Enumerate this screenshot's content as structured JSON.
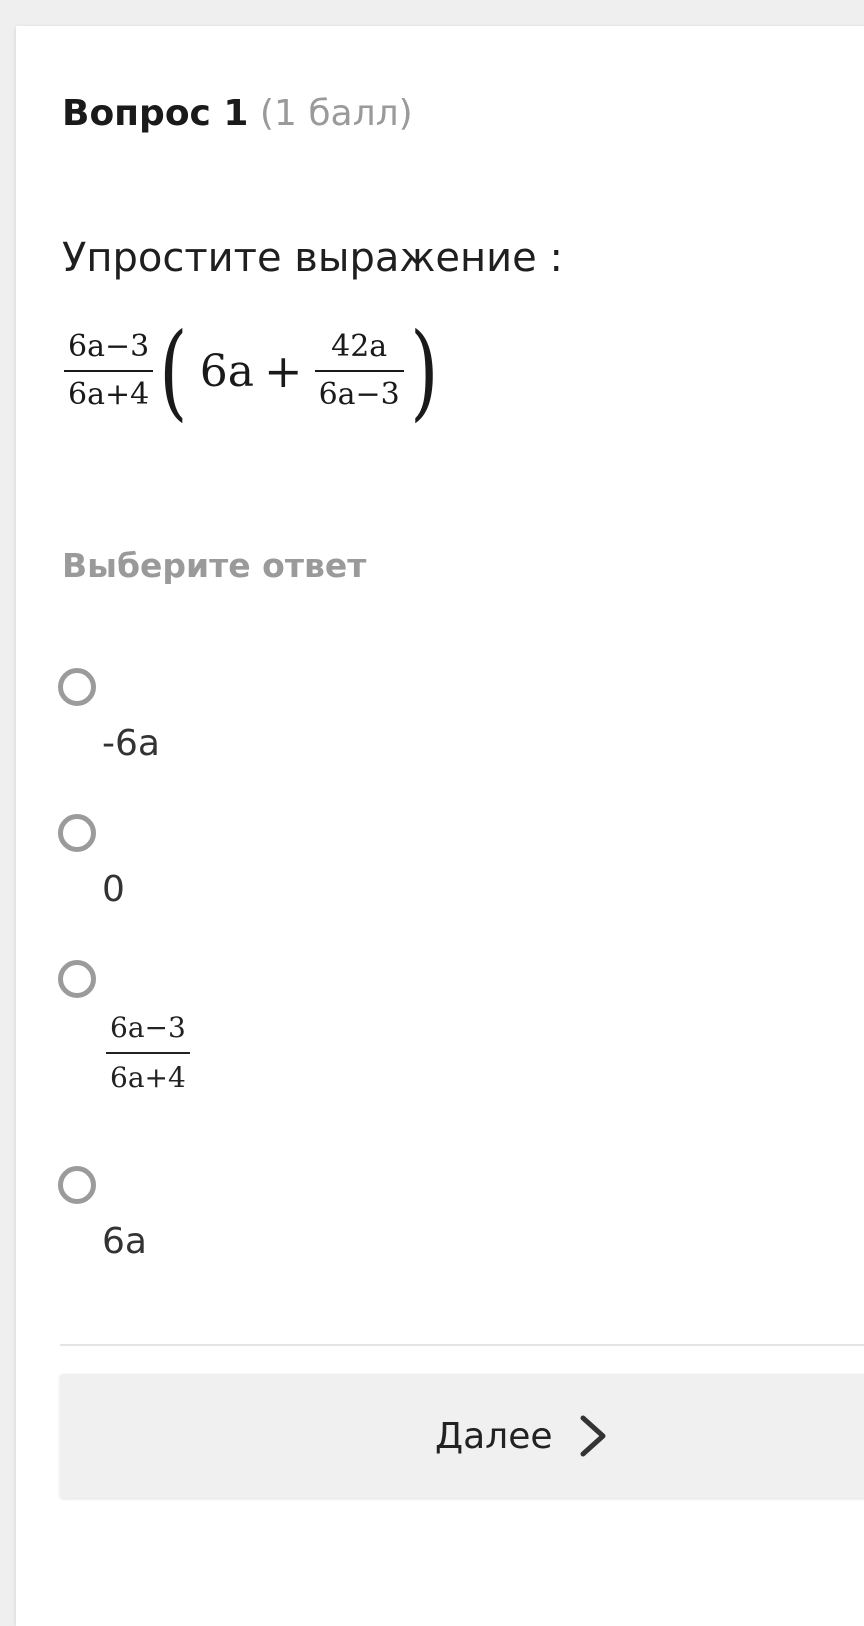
{
  "question": {
    "title": "Вопрос 1",
    "points": "(1 балл)",
    "text": "Упростите выражение :",
    "expression": {
      "outer_fraction": {
        "numerator": "6a−3",
        "denominator": "6a+4"
      },
      "open_paren": "(",
      "term": "6a",
      "operator": "+",
      "inner_fraction": {
        "numerator": "42a",
        "denominator": "6a−3"
      },
      "close_paren": ")"
    }
  },
  "answers": {
    "label": "Выберите ответ",
    "options": [
      {
        "label": "-6a",
        "selected": false
      },
      {
        "label": "0",
        "selected": false
      },
      {
        "label": "",
        "fraction": {
          "numerator": "6a−3",
          "denominator": "6a+4"
        },
        "selected": false
      },
      {
        "label": "6a",
        "selected": false
      }
    ]
  },
  "footer": {
    "next_label": "Далее",
    "next_icon": "chevron-right-icon"
  }
}
